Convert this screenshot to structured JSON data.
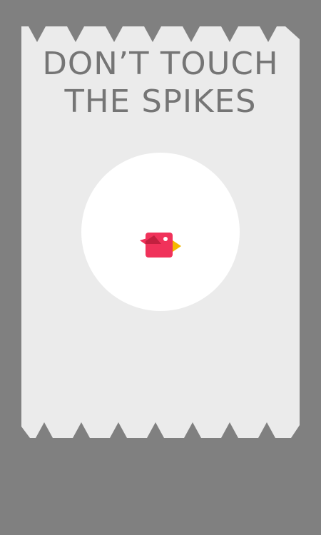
{
  "game": {
    "title_line1": "DON’T TOUCH",
    "title_line2": "THE SPIKES"
  },
  "colors": {
    "outer_background": "#808080",
    "arena_background": "#ebebeb",
    "spike": "#808080",
    "title_text": "#757575",
    "circle": "#ffffff",
    "bird_body": "#f0325a",
    "bird_wing": "#c2203f",
    "bird_beak": "#f5b800",
    "bird_eye": "#ffffff"
  },
  "icons": {
    "player": "bird-icon",
    "hazard": "spike-icon"
  }
}
